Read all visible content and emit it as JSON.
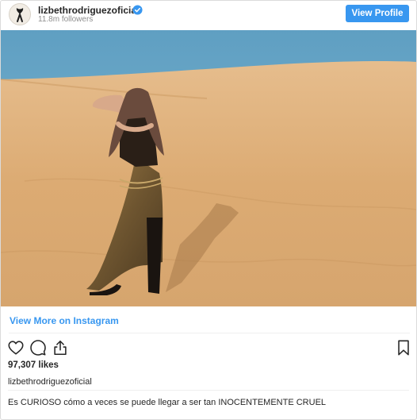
{
  "header": {
    "username": "lizbethrodriguezoficial",
    "verified": true,
    "followers": "11.8m followers",
    "view_profile_label": "View Profile"
  },
  "post": {
    "image_alt": "Woman posing in a sequined dress and tall black boots on a sand dune with a blue sky behind",
    "view_more_label": "View More on Instagram",
    "likes": "97,307 likes",
    "caption_username": "lizbethrodriguezoficial",
    "caption_text": "Es CURIOSO cómo a veces se puede llegar a ser tan INOCENTEMENTE CRUEL"
  },
  "icons": {
    "like": "heart-icon",
    "comment": "comment-icon",
    "share": "share-icon",
    "save": "bookmark-icon"
  },
  "colors": {
    "accent": "#3897f0",
    "text": "#262626",
    "muted": "#8e8e8e",
    "border": "#dbdbdb",
    "sky": "#6fa8c9",
    "sand": "#dcae78"
  }
}
